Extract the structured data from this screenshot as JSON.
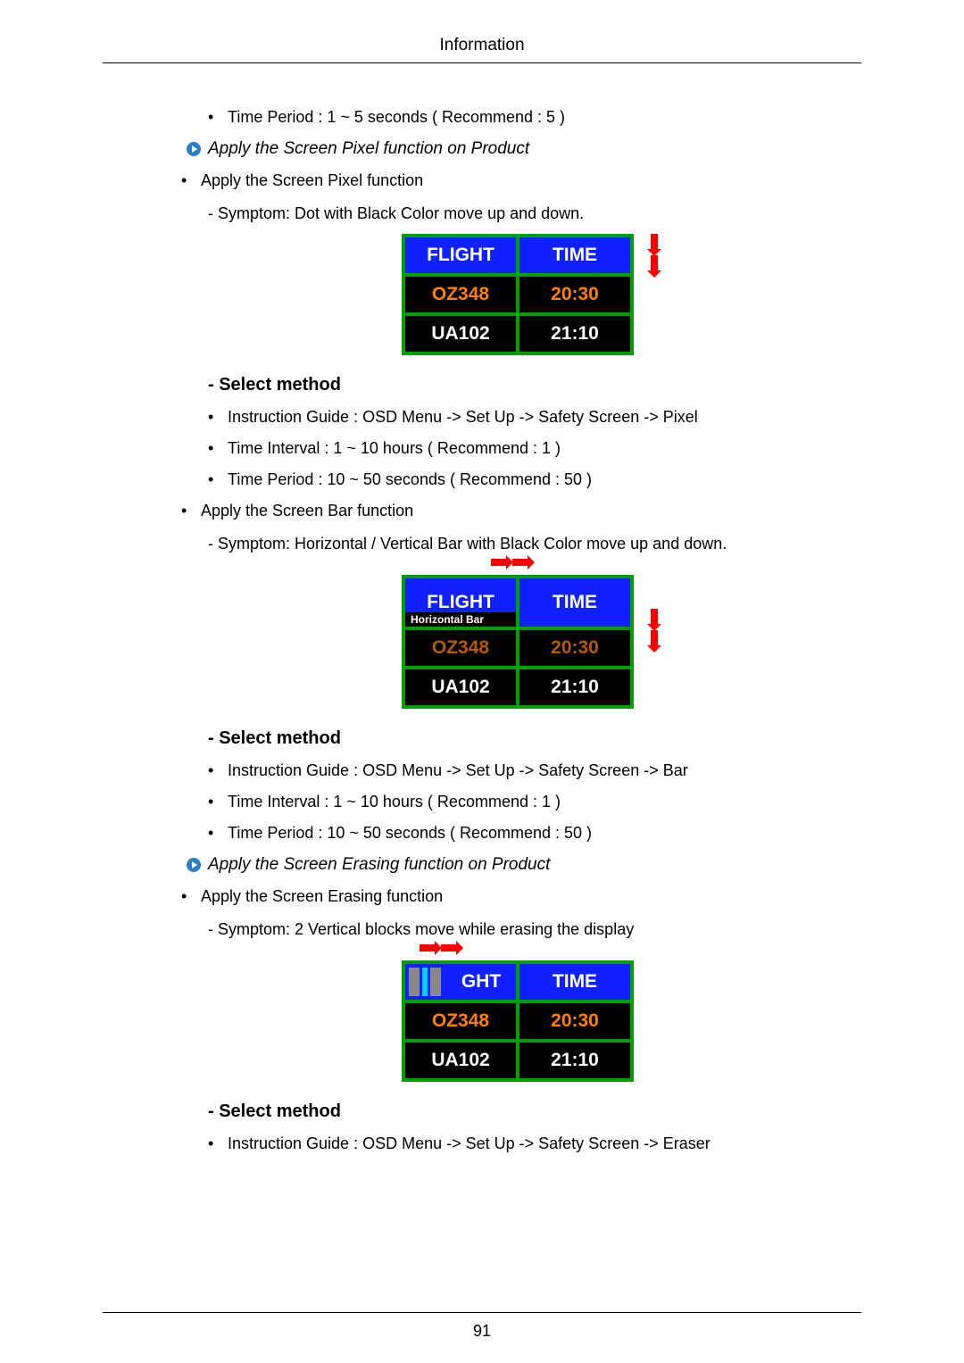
{
  "header": {
    "title": "Information"
  },
  "footer": {
    "page_number": "91"
  },
  "sections": {
    "pixel": {
      "time_period": "Time Period : 1 ~ 5 seconds ( Recommend : 5 )",
      "apply_heading": "Apply the Screen Pixel function on Product",
      "apply_item": "Apply the Screen Pixel function",
      "symptom": "- Symptom: Dot with Black Color move up and down.",
      "select_method": "- Select method",
      "instruction": "Instruction Guide : OSD Menu -> Set Up -> Safety Screen -> Pixel",
      "interval": "Time Interval : 1 ~ 10 hours ( Recommend : 1 )",
      "period2": "Time Period : 10 ~ 50 seconds ( Recommend : 50 )"
    },
    "bar": {
      "apply_item": "Apply the Screen Bar function",
      "symptom": "- Symptom: Horizontal / Vertical Bar with Black Color move up and down.",
      "horizontal_bar_label": "Horizontal Bar",
      "select_method": "- Select method",
      "instruction": "Instruction Guide : OSD Menu -> Set Up -> Safety Screen -> Bar",
      "interval": "Time Interval : 1 ~ 10 hours ( Recommend : 1 )",
      "period": "Time Period : 10 ~ 50 seconds ( Recommend : 50 )"
    },
    "erasing": {
      "apply_heading": "Apply the Screen Erasing function on Product",
      "apply_item": "Apply the Screen Erasing function",
      "symptom": "- Symptom: 2 Vertical blocks move while erasing the display",
      "select_method": "- Select method",
      "instruction": "Instruction Guide : OSD Menu -> Set Up -> Safety Screen -> Eraser"
    }
  },
  "flight_table": {
    "headers": {
      "left": "FLIGHT",
      "right": "TIME"
    },
    "rows": [
      {
        "flight": "OZ348",
        "time": "20:30"
      },
      {
        "flight": "UA102",
        "time": "21:10"
      }
    ],
    "erased_left_header_fragment": "GHT"
  }
}
